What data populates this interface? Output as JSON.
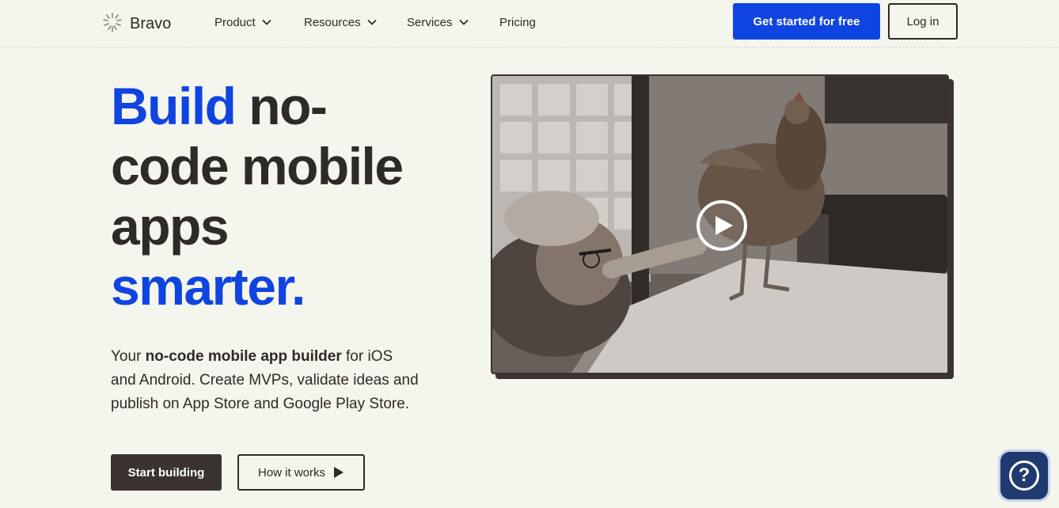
{
  "header": {
    "logo_text": "Bravo",
    "nav": [
      {
        "label": "Product",
        "has_dropdown": true
      },
      {
        "label": "Resources",
        "has_dropdown": true
      },
      {
        "label": "Services",
        "has_dropdown": true
      },
      {
        "label": "Pricing",
        "has_dropdown": false
      }
    ],
    "cta_label": "Get started for free",
    "login_label": "Log in"
  },
  "hero": {
    "headline_blue_1": "Build",
    "headline_dark_1": " no-",
    "headline_dark_2": "code mobile",
    "headline_dark_3": "apps",
    "headline_blue_2": "smarter.",
    "desc_prefix": "Your ",
    "desc_bold": "no-code mobile app builder",
    "desc_suffix": " for iOS and Android. Create MVPs, validate ideas and publish on App Store and Google Play Store.",
    "primary_button": "Start building",
    "secondary_button": "How it works"
  },
  "help": {
    "glyph": "?"
  },
  "colors": {
    "background": "#f4f5ec",
    "accent_blue": "#1044e0",
    "dark": "#2e2a27",
    "help_bg": "#1f3a6e"
  },
  "icons": [
    "logo-icon",
    "chevron-down-icon",
    "play-icon",
    "play-circle-icon",
    "help-icon"
  ]
}
